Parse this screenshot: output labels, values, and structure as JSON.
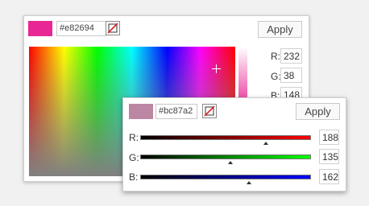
{
  "main_picker": {
    "hex": "#e82694",
    "swatch_color": "#e82694",
    "apply_label": "Apply",
    "channels": [
      {
        "label": "R:",
        "value": "232"
      },
      {
        "label": "G:",
        "value": "38"
      },
      {
        "label": "B:",
        "value": "148"
      }
    ]
  },
  "rgb_picker": {
    "hex": "#bc87a2",
    "swatch_color": "#bc87a2",
    "apply_label": "Apply",
    "channels": [
      {
        "label": "R:",
        "value": "188",
        "level": 0.737,
        "color": "#ff0000"
      },
      {
        "label": "G:",
        "value": "135",
        "level": 0.529,
        "color": "#00ff00"
      },
      {
        "label": "B:",
        "value": "162",
        "level": 0.635,
        "color": "#0000ff"
      }
    ]
  },
  "icons": {
    "no_color": "no-color-icon",
    "crosshair": "crosshair-icon",
    "thumb": "slider-thumb-icon"
  }
}
